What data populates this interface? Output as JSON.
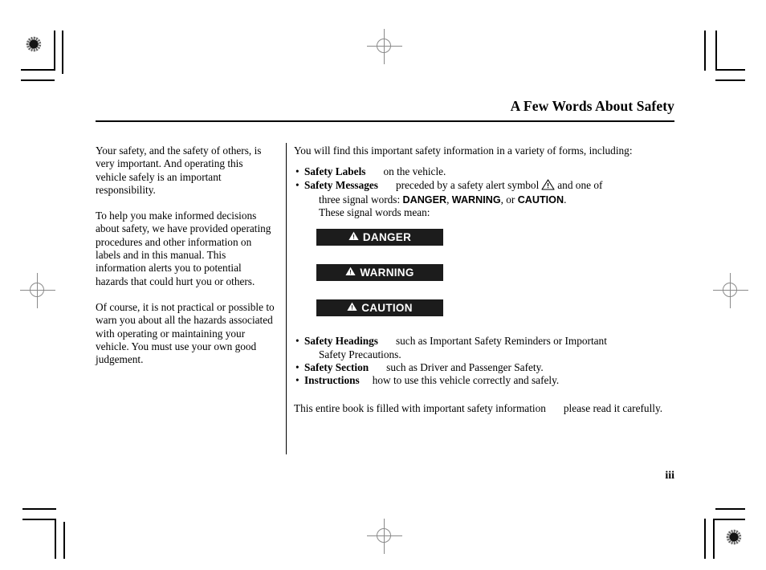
{
  "header": {
    "title": "A Few Words About Safety"
  },
  "left_column": {
    "paragraphs": [
      "Your safety, and the safety of others, is very important. And operating this vehicle safely is an important responsibility.",
      "To help you make informed decisions about safety, we have provided operating procedures and other information on labels and in this manual. This information alerts you to potential hazards that could hurt you or others.",
      "Of course, it is not practical or possible to warn you about all the hazards associated with operating or maintaining your vehicle. You must use your own good judgement."
    ]
  },
  "right_column": {
    "intro": "You will find this important safety information in a variety of forms, including:",
    "bullets_upper": [
      {
        "label": "Safety Labels",
        "text": "on the vehicle."
      },
      {
        "label": "Safety Messages",
        "text": "preceded by a safety alert symbol",
        "text_after_symbol": "and one of",
        "continuation_prefix": "three signal words:",
        "signal_word_1": "DANGER",
        "signal_sep_1": ",",
        "signal_word_2": "WARNING",
        "signal_sep_2": ", or",
        "signal_word_3": "CAUTION",
        "signal_sep_3": ".",
        "closing_line": "These signal words mean:"
      }
    ],
    "signal_boxes": [
      {
        "label": "DANGER",
        "icon": "warning-triangle-icon"
      },
      {
        "label": "WARNING",
        "icon": "warning-triangle-icon"
      },
      {
        "label": "CAUTION",
        "icon": "warning-triangle-icon"
      }
    ],
    "bullets_lower": [
      {
        "label": "Safety Headings",
        "text": "such as Important Safety Reminders or Important",
        "text_line2": "Safety Precautions."
      },
      {
        "label": "Safety Section",
        "text": "such as Driver and Passenger Safety."
      },
      {
        "label": "Instructions",
        "text": "how to use this vehicle correctly and safely."
      }
    ],
    "closing": "This entire book is filled with important safety information",
    "closing_after_dash": "please read it carefully."
  },
  "footer": {
    "page_number": "iii"
  },
  "print_marks": {
    "registration_target_icon": "registration-target-icon",
    "crosshair_icon": "registration-crosshair-icon",
    "crop_mark_icon": "crop-mark-icon"
  },
  "colors": {
    "signal_box_background": "#1c1c1c",
    "signal_box_text": "#ffffff",
    "ink": "#000000",
    "paper": "#ffffff"
  },
  "bullet_glyph": "•"
}
